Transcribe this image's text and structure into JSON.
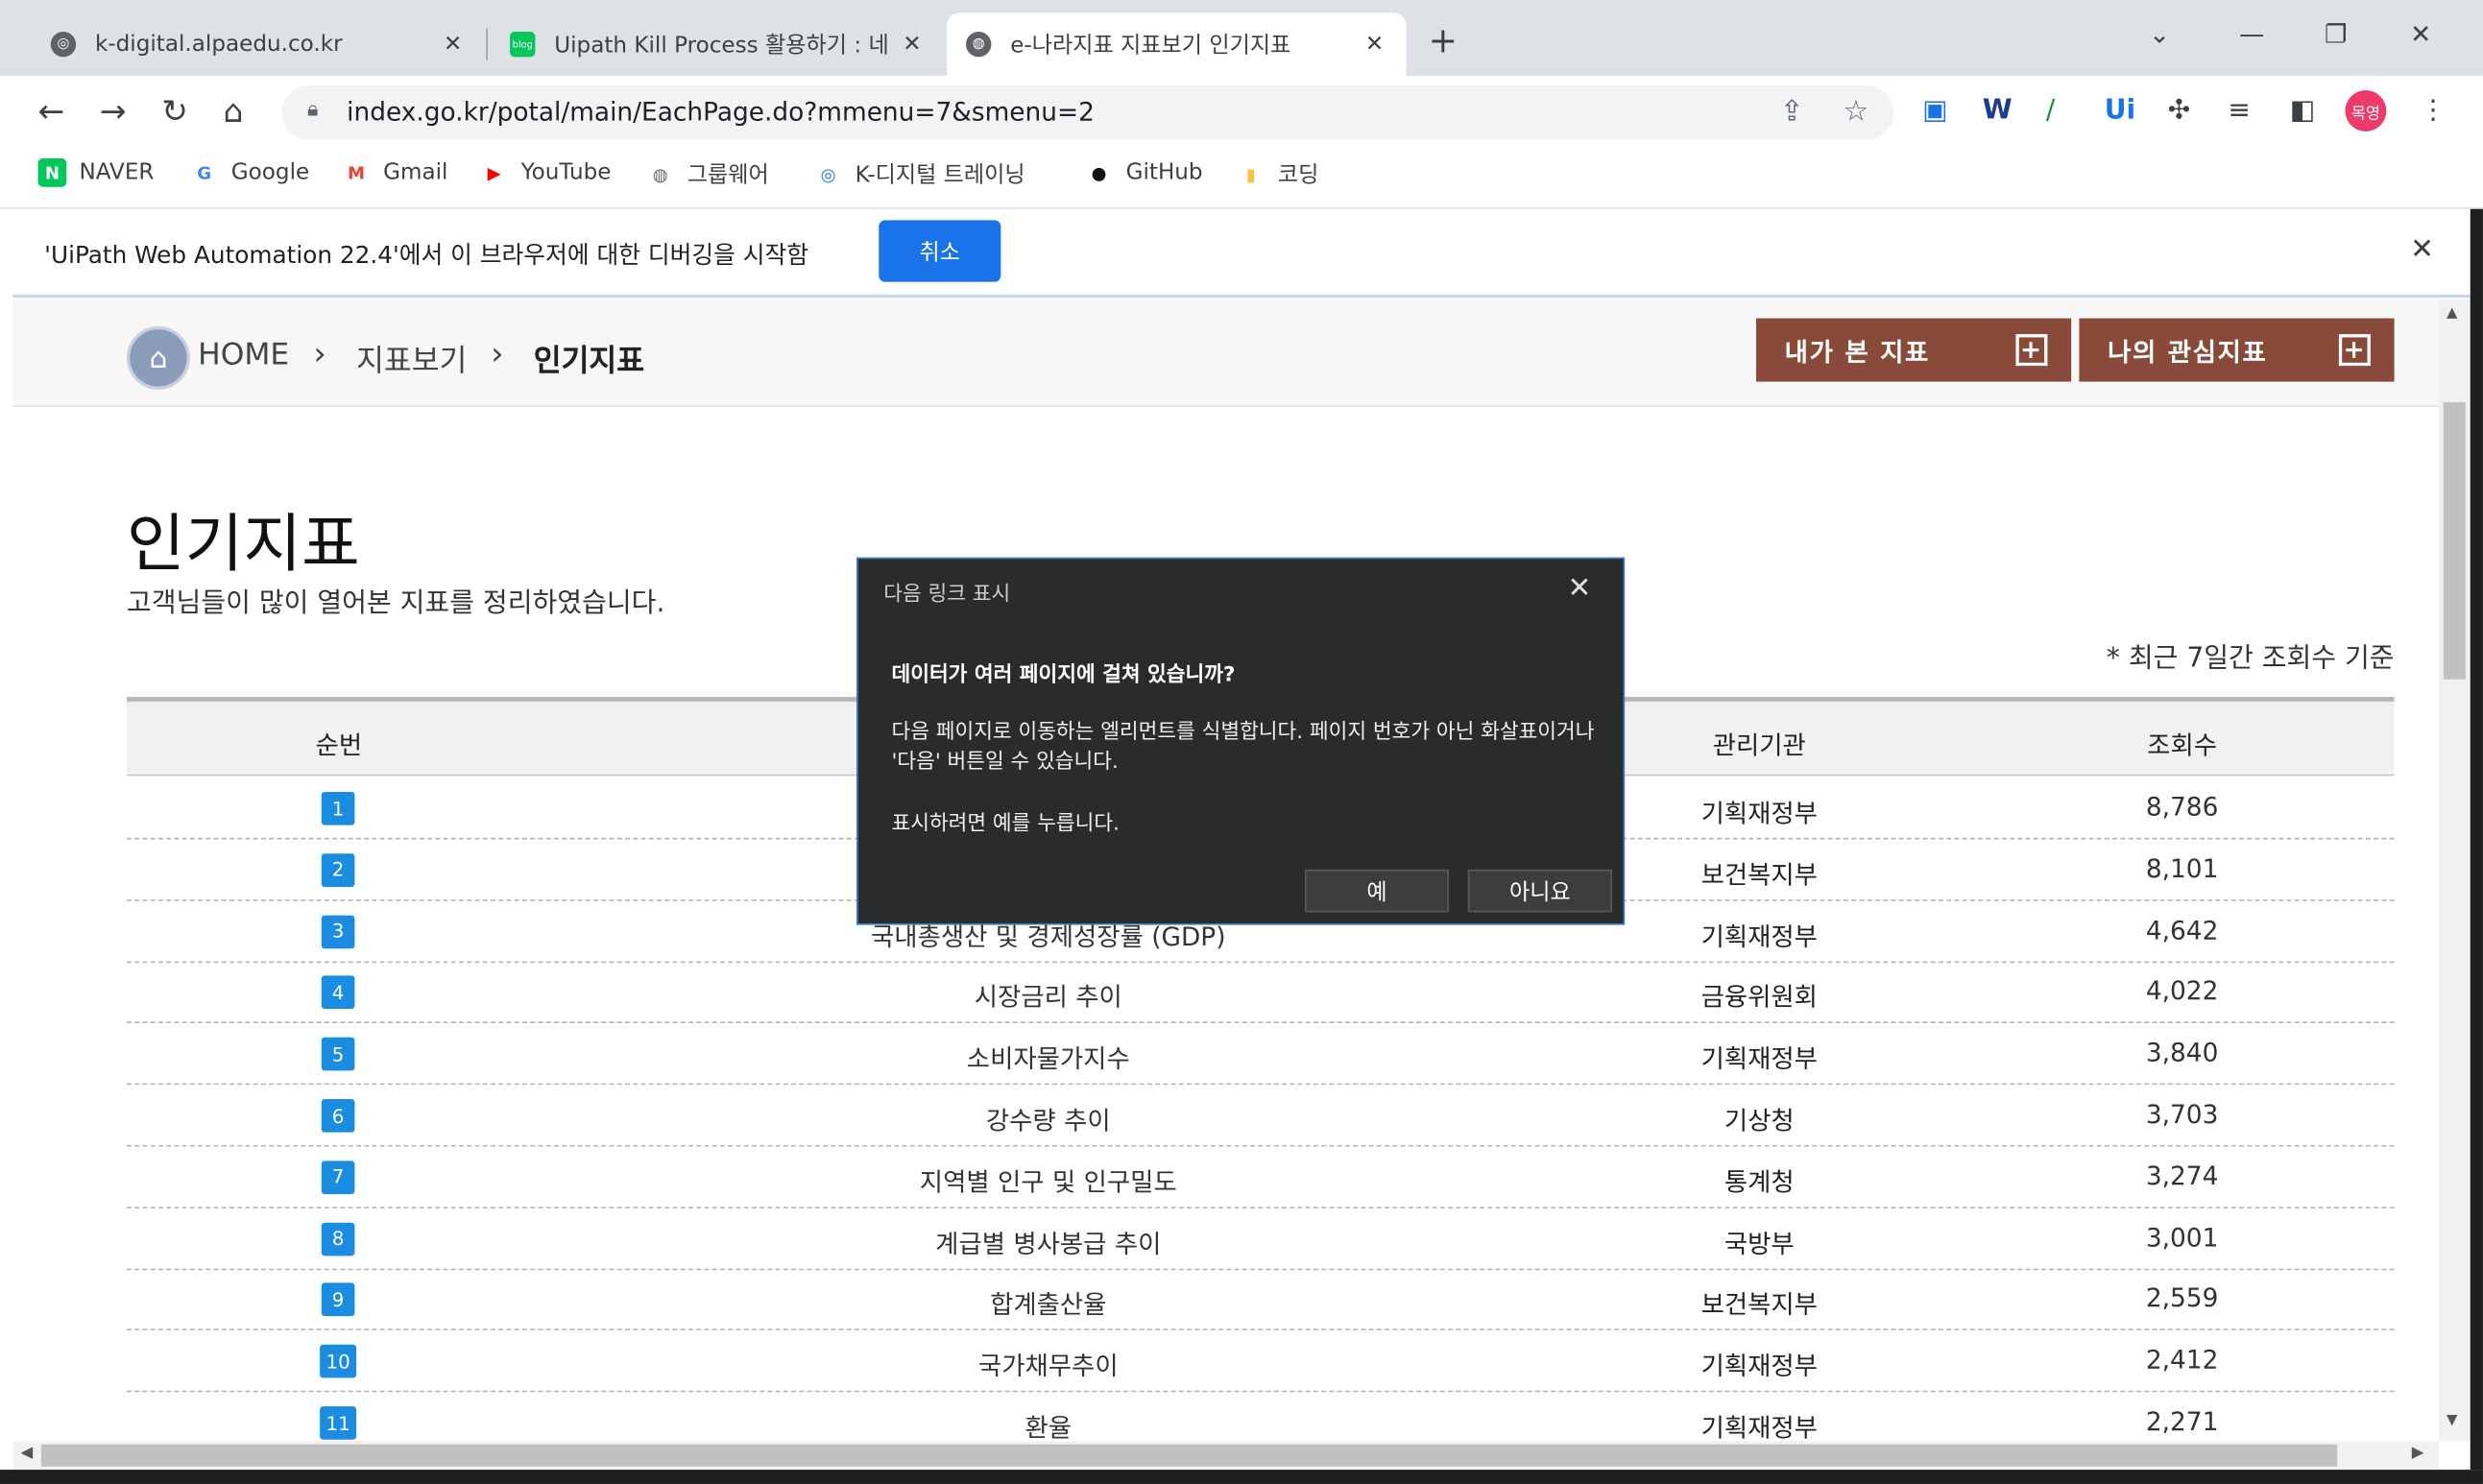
{
  "browser": {
    "tabs": [
      {
        "title": "k-digital.alpaedu.co.kr",
        "favicon": "alpaco-icon",
        "close": "✕"
      },
      {
        "title": "Uipath Kill Process 활용하기 : 네",
        "favicon": "blog-icon",
        "favicon_text": "blog",
        "close": "✕"
      },
      {
        "title": "e-나라지표 지표보기 인기지표",
        "favicon": "globe-icon",
        "close": "✕"
      }
    ],
    "new_tab": "+",
    "url": "index.go.kr/potal/main/EachPage.do?mmenu=7&smenu=2",
    "profile_label": "목영",
    "bookmarks": [
      {
        "label": "NAVER",
        "icon": "naver-icon",
        "glyph": "N",
        "color": "#03c75a"
      },
      {
        "label": "Google",
        "icon": "google-icon",
        "glyph": "G",
        "color": "#4285f4"
      },
      {
        "label": "Gmail",
        "icon": "gmail-icon",
        "glyph": "M",
        "color": "#ea4335"
      },
      {
        "label": "YouTube",
        "icon": "youtube-icon",
        "glyph": "▶",
        "color": "#ff0000"
      },
      {
        "label": "그룹웨어",
        "icon": "globe-icon",
        "glyph": "◍",
        "color": "#5f6368"
      },
      {
        "label": "K-디지털 트레이닝",
        "icon": "alpaco-icon",
        "glyph": "◎",
        "color": "#1a73e8"
      },
      {
        "label": "GitHub",
        "icon": "github-icon",
        "glyph": "●",
        "color": "#111111"
      },
      {
        "label": "코딩",
        "icon": "folder-icon",
        "glyph": "▮",
        "color": "#f6c344"
      }
    ]
  },
  "infobar": {
    "message": "'UiPath Web Automation 22.4'에서 이 브라우저에 대한 디버깅을 시작함",
    "cancel_label": "취소"
  },
  "page": {
    "breadcrumb": {
      "home": "HOME",
      "level1": "지표보기",
      "level2": "인기지표"
    },
    "buttons": {
      "viewed": "내가 본 지표",
      "interest": "나의 관심지표"
    },
    "title": "인기지표",
    "subtitle": "고객님들이 많이 열어본 지표를 정리하였습니다.",
    "note": "* 최근 7일간 조회수 기준",
    "table": {
      "headers": {
        "rank": "순번",
        "agency": "관리기관",
        "views": "조회수"
      },
      "rows": [
        {
          "rank": "1",
          "name": "",
          "agency": "기획재정부",
          "views": "8,786"
        },
        {
          "rank": "2",
          "name": "",
          "agency": "보건복지부",
          "views": "8,101"
        },
        {
          "rank": "3",
          "name": "국내총생산 및 경제성장률 (GDP)",
          "agency": "기획재정부",
          "views": "4,642"
        },
        {
          "rank": "4",
          "name": "시장금리 추이",
          "agency": "금융위원회",
          "views": "4,022"
        },
        {
          "rank": "5",
          "name": "소비자물가지수",
          "agency": "기획재정부",
          "views": "3,840"
        },
        {
          "rank": "6",
          "name": "강수량 추이",
          "agency": "기상청",
          "views": "3,703"
        },
        {
          "rank": "7",
          "name": "지역별 인구 및 인구밀도",
          "agency": "통계청",
          "views": "3,274"
        },
        {
          "rank": "8",
          "name": "계급별 병사봉급 추이",
          "agency": "국방부",
          "views": "3,001"
        },
        {
          "rank": "9",
          "name": "합계출산율",
          "agency": "보건복지부",
          "views": "2,559"
        },
        {
          "rank": "10",
          "name": "국가채무추이",
          "agency": "기획재정부",
          "views": "2,412"
        },
        {
          "rank": "11",
          "name": "환율",
          "agency": "기획재정부",
          "views": "2,271"
        }
      ]
    }
  },
  "dialog": {
    "title": "다음 링크 표시",
    "question": "데이터가 여러 페이지에 걸쳐 있습니까?",
    "body": "다음 페이지로 이동하는 엘리먼트를 식별합니다. 페이지 번호가 아닌 화살표이거나 '다음' 버튼일 수 있습니다.",
    "hint": "표시하려면 예를 누릅니다.",
    "yes_label": "예",
    "no_label": "아니요"
  }
}
